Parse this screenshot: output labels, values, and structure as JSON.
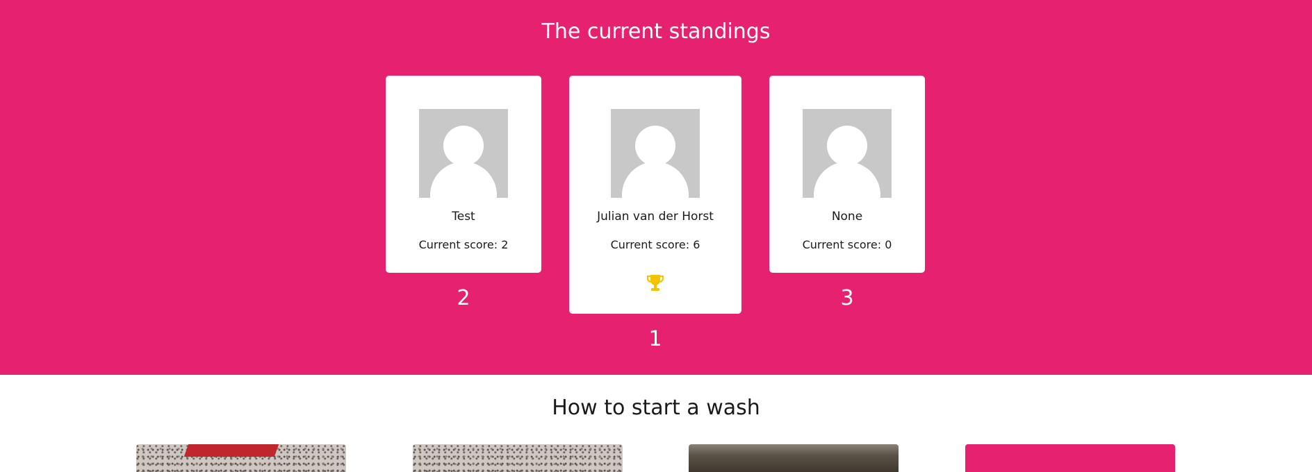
{
  "standings": {
    "title": "The current standings",
    "cards": [
      {
        "name": "Test",
        "score_text": "Current score: 2",
        "rank": "2"
      },
      {
        "name": "Julian van der Horst",
        "score_text": "Current score: 6",
        "rank": "1"
      },
      {
        "name": "None",
        "score_text": "Current score: 0",
        "rank": "3"
      }
    ],
    "winner_icon": "trophy-icon",
    "accent_color": "#e62270",
    "trophy_color": "#f3c300"
  },
  "howto": {
    "title": "How to start a wash",
    "tiles": [
      {
        "image": "granite-photo-with-red-tag"
      },
      {
        "image": "granite-photo"
      },
      {
        "image": "dark-photo"
      },
      {
        "image": "pink-tile"
      }
    ]
  }
}
